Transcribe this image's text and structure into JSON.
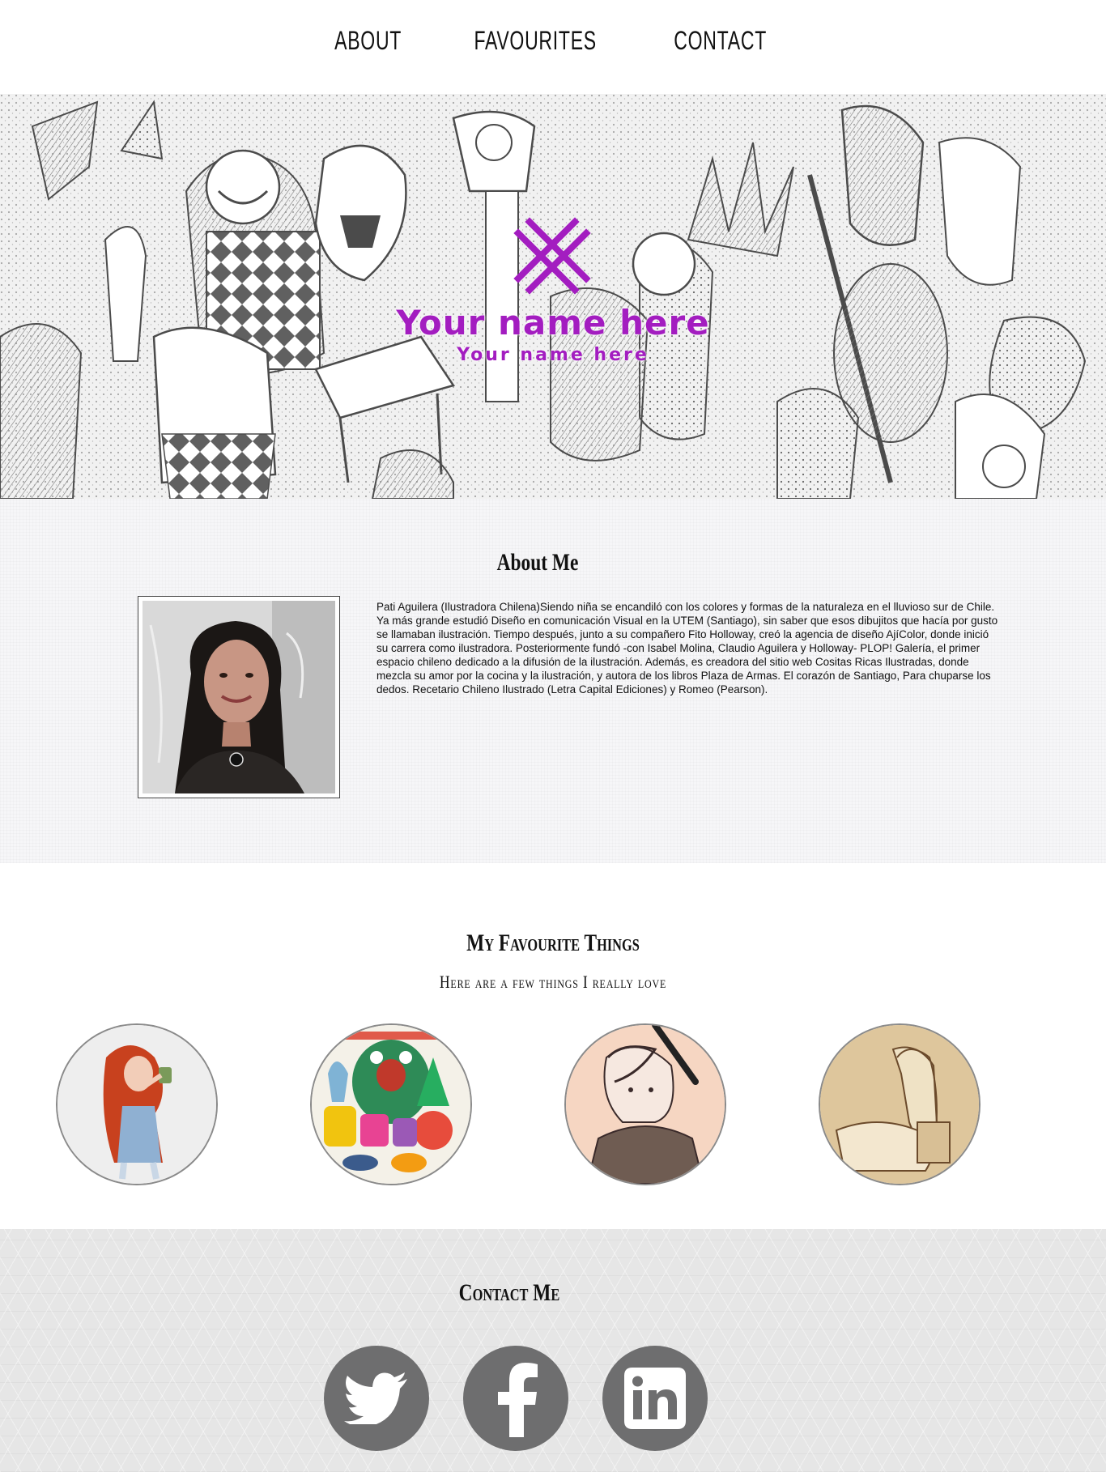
{
  "nav": {
    "items": [
      {
        "label": "About"
      },
      {
        "label": "Favourites"
      },
      {
        "label": "Contact"
      }
    ]
  },
  "hero": {
    "title": "Your name here",
    "subtitle": "Your name here",
    "accent_color": "#a31dc0",
    "logo_icon": "cross-hatch-logo-icon"
  },
  "about": {
    "title": "About Me",
    "bio": "Pati Aguilera (Ilustradora Chilena)Siendo niña se encandiló con los colores y formas de la naturaleza en el lluvioso sur de Chile. Ya más grande estudió Diseño en comunicación Visual en la UTEM (Santiago), sin saber que esos dibujitos que hacía por gusto se llamaban ilustración. Tiempo después, junto a su compañero Fito Holloway, creó la agencia de diseño AjíColor, donde inició su carrera como ilustradora. Posteriormente fundó -con Isabel Molina, Claudio Aguilera y Holloway- PLOP! Galería, el primer espacio chileno dedicado a la difusión de la ilustración. Además, es creadora del sitio web Cositas Ricas Ilustradas, donde mezcla su amor por la cocina y la ilustración, y autora de los libros Plaza de Armas. El corazón de Santiago, Para chuparse los dedos. Recetario Chileno Ilustrado (Letra Capital Ediciones) y Romeo (Pearson)."
  },
  "favourites": {
    "title": "My Favourite Things",
    "subtitle": "Here are a few things I really love"
  },
  "contact": {
    "title": "Contact Me",
    "icons": [
      "twitter-icon",
      "facebook-icon",
      "linkedin-icon"
    ],
    "icon_color": "#6e6e6f"
  }
}
